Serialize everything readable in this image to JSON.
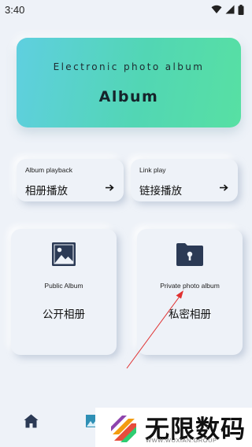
{
  "status_bar": {
    "time": "3:40",
    "icons": [
      "wifi-icon",
      "cellular-signal-icon",
      "battery-icon"
    ]
  },
  "banner": {
    "subtitle": "Electronic photo album",
    "title": "Album",
    "gradient_colors": [
      "#5fcfe0",
      "#57e0a3"
    ]
  },
  "shortcuts": [
    {
      "label_en": "Album playback",
      "label_zh": "相册播放",
      "icon": "arrow-right-icon"
    },
    {
      "label_en": "Link play",
      "label_zh": "链接播放",
      "icon": "arrow-right-icon"
    }
  ],
  "albums": [
    {
      "label_en": "Public Album",
      "label_zh": "公开相册",
      "icon": "image-icon"
    },
    {
      "label_en": "Private photo album",
      "label_zh": "私密相册",
      "icon": "locked-folder-icon"
    }
  ],
  "bottom_nav": {
    "items": [
      "home-icon",
      "album-icon"
    ]
  },
  "watermark": {
    "text": "无限数码",
    "subtext": "WWW.WUXIAN.GROUP"
  },
  "colors": {
    "background": "#eef2f8",
    "icon": "#2b3a55",
    "annotation_arrow": "#e03030"
  }
}
